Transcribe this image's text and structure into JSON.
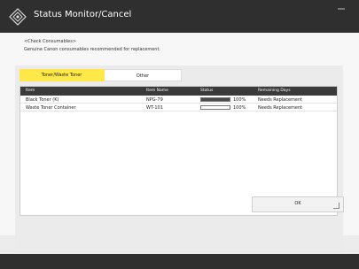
{
  "window": {
    "title": "Status Monitor/Cancel"
  },
  "intro": {
    "heading": "<Check Consumables>",
    "subheading": "Genuine Canon consumables recommended for replacement."
  },
  "tabs": [
    {
      "label": "Toner/Waste Toner",
      "active": true
    },
    {
      "label": "Other",
      "active": false
    }
  ],
  "table": {
    "headers": {
      "item": "Item",
      "item_name": "Item Name",
      "status": "Status",
      "remaining_days": "Remaining Days"
    },
    "rows": [
      {
        "item": "Black Toner (K)",
        "item_name": "NPG-79",
        "status_level": 100,
        "status_text": "100%",
        "remaining": "Needs Replacement"
      },
      {
        "item": "Waste Toner Container",
        "item_name": "WT-101",
        "status_level": 0,
        "status_text": "100%",
        "remaining": "Needs Replacement"
      }
    ]
  },
  "actions": {
    "ok_label": "OK"
  },
  "colors": {
    "active_tab": "#ffe84a",
    "header_bar": "#2f2f2f"
  },
  "icons": {
    "title_icon": "settings-diamond-icon",
    "menu_icon": "menu-icon",
    "ok_corner_icon": "resize-corner-icon"
  }
}
